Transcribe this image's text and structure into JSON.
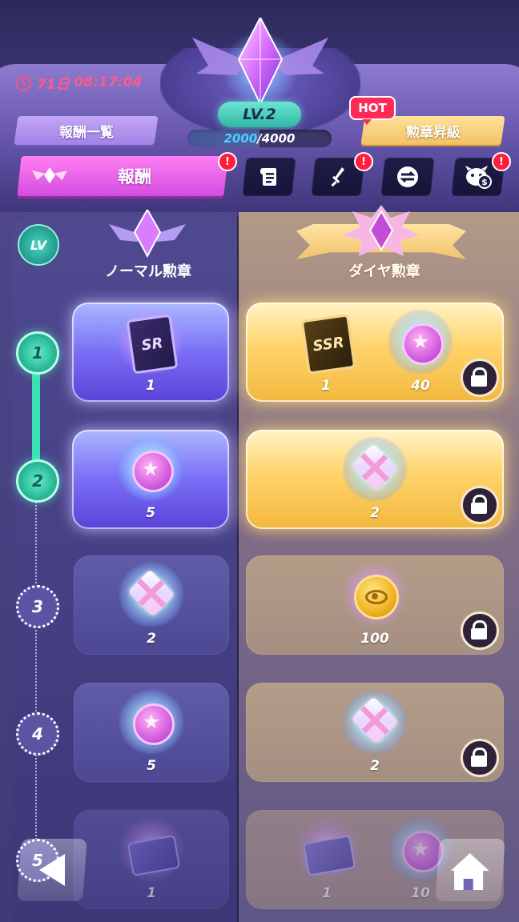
{
  "header": {
    "timer": {
      "days": "71日",
      "time": "08:17:04"
    },
    "level": "LV.2",
    "xp": {
      "current": "2000",
      "separator": "/",
      "max": "4000",
      "fraction": 0.5
    },
    "rewards_list_label": "報酬一覧",
    "upgrade_label": "勲章昇級",
    "hot_label": "HOT"
  },
  "tabs": {
    "main_label": "報酬",
    "alert_mark": "!",
    "icons": [
      "scroll-icon",
      "sword-icon",
      "exchange-icon",
      "pet-coin-icon"
    ]
  },
  "columns": {
    "lv_badge": "LV",
    "normal_title": "ノーマル勲章",
    "diamond_title": "ダイヤ勲章"
  },
  "levels": [
    {
      "num": "1",
      "state": "done",
      "normal": [
        {
          "item": "sr-card",
          "label": "SR",
          "qty": "1"
        }
      ],
      "diamond": [
        {
          "item": "ssr-card",
          "label": "SSR",
          "qty": "1"
        },
        {
          "item": "gem-coin",
          "qty": "40"
        }
      ]
    },
    {
      "num": "2",
      "state": "done",
      "normal": [
        {
          "item": "gem-coin",
          "qty": "5"
        }
      ],
      "diamond": [
        {
          "item": "gift-box",
          "qty": "2"
        }
      ]
    },
    {
      "num": "3",
      "state": "todo",
      "normal": [
        {
          "item": "gift-box",
          "qty": "2"
        }
      ],
      "diamond": [
        {
          "item": "gold-coin",
          "qty": "100"
        }
      ]
    },
    {
      "num": "4",
      "state": "todo",
      "normal": [
        {
          "item": "gem-coin",
          "qty": "5"
        }
      ],
      "diamond": [
        {
          "item": "gift-box",
          "qty": "2"
        }
      ]
    },
    {
      "num": "5",
      "state": "todo",
      "normal": [
        {
          "item": "winged-card",
          "qty": "1"
        }
      ],
      "diamond": [
        {
          "item": "winged-card",
          "qty": "1"
        },
        {
          "item": "gem-coin",
          "qty": "10"
        }
      ]
    }
  ],
  "colors": {
    "accent_pink": "#d44ee0",
    "track_green": "#39e2b4",
    "alert_red": "#ff1f3d",
    "timer_pink": "#ff5a8a",
    "gold": "#f2c264"
  }
}
